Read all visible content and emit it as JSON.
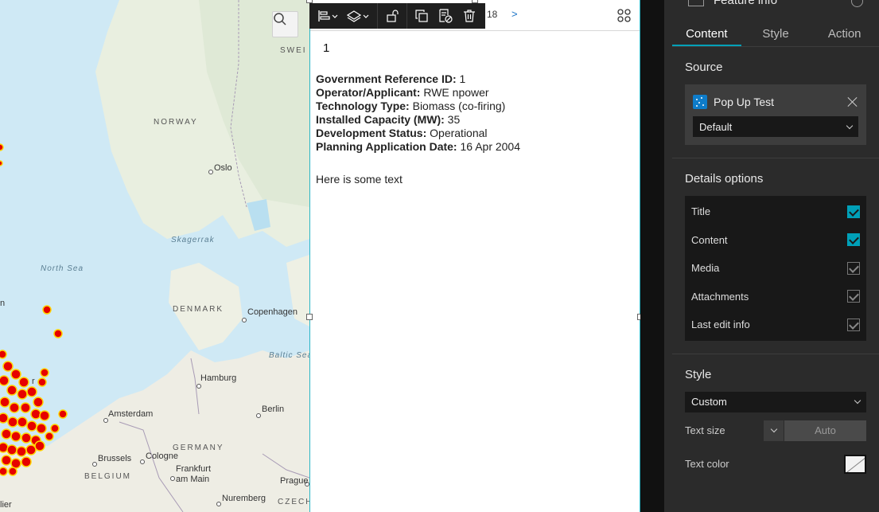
{
  "map": {
    "countries": [
      "SWEDEN",
      "NORWAY",
      "DENMARK",
      "GERMANY",
      "BELGIUM",
      "CZECH"
    ],
    "country_visible": [
      "SWEI",
      "NORWAY",
      "DENMARK",
      "GERMANY",
      "BELGIUM",
      "CZECH"
    ],
    "seas": [
      "North Sea",
      "Skagerrak",
      "Baltic Sea"
    ],
    "seas_visible": [
      "North Sea",
      "Skagerrak",
      "Baltic Sea"
    ],
    "cities": [
      "Oslo",
      "Copenhagen",
      "Hamburg",
      "Amsterdam",
      "Berlin",
      "Cologne",
      "Brussels",
      "Frankfurt am Main",
      "Prague",
      "Nuremberg"
    ],
    "edge_labels": [
      "n",
      "r",
      "lier"
    ],
    "search_icon": "search-icon",
    "marker_color": "#e60000",
    "marker_outline": "#ffd400"
  },
  "widget": {
    "toolbar_icons": [
      "align-icon",
      "layers-icon",
      "unlock-icon",
      "duplicate-icon",
      "save-template-icon",
      "delete-icon"
    ],
    "pager_number": "18",
    "pager_next": ">",
    "record_title": "1",
    "fields": [
      {
        "label": "Government Reference ID:",
        "value": " 1"
      },
      {
        "label": "Operator/Applicant:",
        "value": " RWE npower"
      },
      {
        "label": "Technology Type:",
        "value": " Biomass (co-firing)"
      },
      {
        "label": "Installed Capacity (MW):",
        "value": " 35"
      },
      {
        "label": "Development Status:",
        "value": " Operational"
      },
      {
        "label": "Planning Application Date:",
        "value": " 16 Apr 2004"
      }
    ],
    "extra_text": "Here is some text",
    "accent": "#29b6c6"
  },
  "panel": {
    "header_title": "Feature info",
    "tabs": [
      "Content",
      "Style",
      "Action"
    ],
    "active_tab": "Content",
    "source": {
      "title": "Source",
      "name": "Pop Up Test",
      "view_select": "Default"
    },
    "details": {
      "title": "Details options",
      "options": [
        {
          "label": "Title",
          "checked": true
        },
        {
          "label": "Content",
          "checked": true
        },
        {
          "label": "Media",
          "checked": false
        },
        {
          "label": "Attachments",
          "checked": false
        },
        {
          "label": "Last edit info",
          "checked": false
        }
      ]
    },
    "style": {
      "title": "Style",
      "select": "Custom",
      "text_size_label": "Text size",
      "text_size_value": "Auto",
      "text_color_label": "Text color"
    },
    "accent": "#00a0b8"
  }
}
